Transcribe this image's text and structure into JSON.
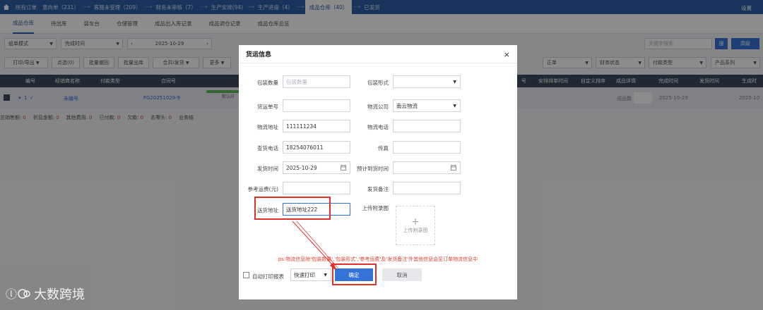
{
  "topbar": {
    "crumbs": [
      {
        "label": "所有订单"
      },
      {
        "label": "意向单（231）"
      },
      {
        "label": "客服未受理（209）"
      },
      {
        "label": "财务未审核（7）"
      },
      {
        "label": "生产安排(94)"
      },
      {
        "label": "生产进度（4）"
      },
      {
        "label": "成品仓库（40）"
      },
      {
        "label": "已发货"
      }
    ],
    "settings": "设置"
  },
  "subtabs": [
    "成品仓库",
    "待出库",
    "装车台",
    "仓储管理",
    "成品出入库记录",
    "成品调仓记录",
    "成品仓库总览"
  ],
  "filters": {
    "mode": "组单模式",
    "time_type": "完成时间",
    "date": "2025-10-29",
    "search_placeholder": "关键字搜索",
    "search_btn": "搜",
    "advanced_btn": "高级"
  },
  "toolbar": {
    "buttons": [
      "打印/导出",
      "点选(0)",
      "批量撤回",
      "批量出库",
      "合并/发货",
      "更多"
    ],
    "right_selects": [
      "正单",
      "财务状态",
      "付款类型",
      "产品系列"
    ]
  },
  "table": {
    "headers": [
      "编号",
      "经销商名称",
      "付款类型",
      "合同号",
      "号",
      "安排排单时间",
      "自定义排序",
      "成品详情",
      "完成时间",
      "发货时间",
      "生成时"
    ],
    "row": {
      "num": "1",
      "dealer": "未编号",
      "contract": "FG20251029-9",
      "progress_label": "默认环",
      "detail": "成品数",
      "finish_time": "2025-10-29",
      "gen_time": "2025-10"
    }
  },
  "summary": [
    {
      "label": "总销售额:",
      "value": "0"
    },
    {
      "label": "折后金额:",
      "value": "0"
    },
    {
      "label": "其他费用:",
      "value": "0"
    },
    {
      "label": "已付款:",
      "value": "0"
    },
    {
      "label": "欠款:",
      "value": "0"
    },
    {
      "label": "去零头:",
      "value": "0"
    },
    {
      "label": "业务结",
      "value": ""
    }
  ],
  "modal": {
    "title": "货运信息",
    "close": "×",
    "fields": {
      "pkg_qty_label": "包装数量",
      "pkg_qty_placeholder": "包装数量",
      "pkg_form_label": "包装形式",
      "waybill_label": "货运单号",
      "logistics_co_label": "物流公司",
      "logistics_co_value": "南云物流",
      "logistics_addr_label": "物流地址",
      "logistics_addr_value": "111111234",
      "logistics_phone_label": "物流电话",
      "query_phone_label": "查货电话",
      "query_phone_value": "18254076011",
      "fax_label": "传真",
      "ship_time_label": "发货时间",
      "ship_time_value": "2025-10-29",
      "eta_label": "预计到货时间",
      "ref_freight_label": "参考运费(元)",
      "ship_note_label": "发货备注",
      "delivery_addr_label": "送货地址",
      "delivery_addr_value": "送货地址222",
      "upload_label": "上传附录图",
      "upload_text": "上传附录图",
      "upload_plus": "+"
    },
    "note": "ps:物流信息除'包装数量','包装形式','参考运费'及'发货备注'外其他信息会至订单物流信息中",
    "auto_print_label": "自动打印报表",
    "print_mode": "快速打印",
    "confirm": "确定",
    "cancel": "取消"
  },
  "watermark": "大数跨境",
  "colors": {
    "topbar": "#2b5fa8",
    "primary": "#3573d6",
    "highlight": "#e0302a",
    "note": "#e03e2d"
  }
}
